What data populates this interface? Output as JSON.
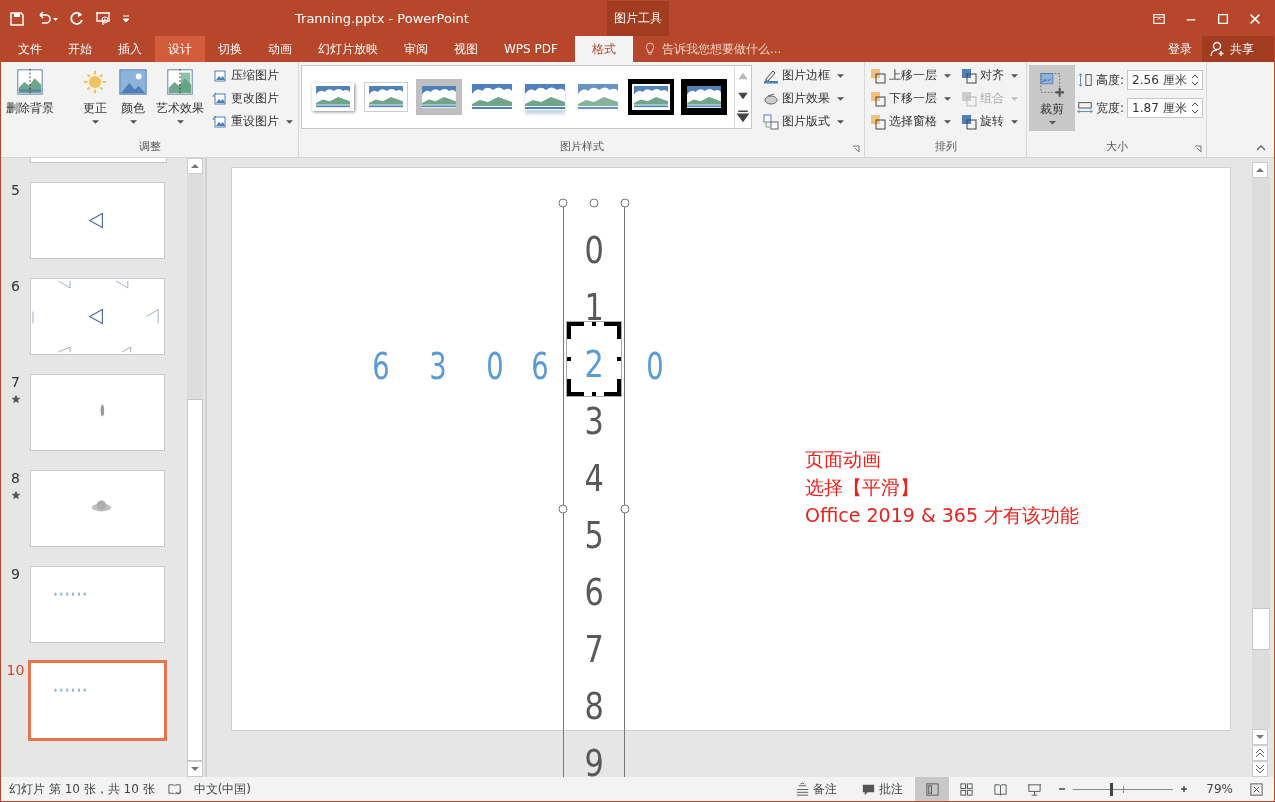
{
  "window": {
    "title": "Tranning.pptx - PowerPoint",
    "context_group": "图片工具"
  },
  "tabs": [
    {
      "label": "文件",
      "selected": false,
      "highlighted": false
    },
    {
      "label": "开始",
      "selected": false,
      "highlighted": false
    },
    {
      "label": "插入",
      "selected": false,
      "highlighted": false
    },
    {
      "label": "设计",
      "selected": false,
      "highlighted": true
    },
    {
      "label": "切换",
      "selected": false,
      "highlighted": false
    },
    {
      "label": "动画",
      "selected": false,
      "highlighted": false
    },
    {
      "label": "幻灯片放映",
      "selected": false,
      "highlighted": false
    },
    {
      "label": "审阅",
      "selected": false,
      "highlighted": false
    },
    {
      "label": "视图",
      "selected": false,
      "highlighted": false
    },
    {
      "label": "WPS PDF",
      "selected": false,
      "highlighted": false
    },
    {
      "label": "格式",
      "selected": true,
      "highlighted": false
    }
  ],
  "tell_me": {
    "placeholder": "告诉我您想要做什么..."
  },
  "sign_in": "登录",
  "share": "共享",
  "ribbon": {
    "adjust": {
      "label": "调整",
      "remove_background": "删除背景",
      "large": [
        {
          "label": "更正"
        },
        {
          "label": "颜色"
        },
        {
          "label": "艺术效果"
        }
      ],
      "small": [
        {
          "label": "压缩图片",
          "dropdown": false
        },
        {
          "label": "更改图片",
          "dropdown": false
        },
        {
          "label": "重设图片",
          "dropdown": true
        }
      ]
    },
    "styles": {
      "label": "图片样式",
      "gallery": [
        {
          "kind": "shadow"
        },
        {
          "kind": "white"
        },
        {
          "kind": "gray"
        },
        {
          "kind": "soft"
        },
        {
          "kind": "reflect"
        },
        {
          "kind": "fade"
        },
        {
          "kind": "double"
        },
        {
          "kind": "black"
        }
      ],
      "commands": [
        {
          "label": "图片边框"
        },
        {
          "label": "图片效果"
        },
        {
          "label": "图片版式"
        }
      ]
    },
    "arrange": {
      "label": "排列",
      "commands": [
        {
          "label": "上移一层",
          "disabled": false
        },
        {
          "label": "对齐",
          "disabled": false
        },
        {
          "label": "下移一层",
          "disabled": false
        },
        {
          "label": "组合",
          "disabled": true
        },
        {
          "label": "选择窗格",
          "disabled": false
        },
        {
          "label": "旋转",
          "disabled": false
        }
      ]
    },
    "size": {
      "label": "大小",
      "crop": {
        "label": "裁剪",
        "selected": true
      },
      "height": {
        "label": "高度:",
        "value": "2.56 厘米"
      },
      "width": {
        "label": "宽度:",
        "value": "1.87 厘米"
      }
    }
  },
  "slides": [
    {
      "number": "5",
      "kind": "triangle",
      "animated": false,
      "selected": false
    },
    {
      "number": "6",
      "kind": "triangles",
      "animated": false,
      "selected": false
    },
    {
      "number": "7",
      "kind": "feather",
      "animated": true,
      "selected": false
    },
    {
      "number": "8",
      "kind": "blur",
      "animated": true,
      "selected": false
    },
    {
      "number": "9",
      "kind": "dots",
      "animated": false,
      "selected": false
    },
    {
      "number": "10",
      "kind": "dots",
      "animated": false,
      "selected": true
    }
  ],
  "slide": {
    "digit_column": [
      {
        "text": "0",
        "highlighted": false
      },
      {
        "text": "1",
        "highlighted": false
      },
      {
        "text": "2",
        "highlighted": true
      },
      {
        "text": "3",
        "highlighted": false
      },
      {
        "text": "4",
        "highlighted": false
      },
      {
        "text": "5",
        "highlighted": false
      },
      {
        "text": "6",
        "highlighted": false
      },
      {
        "text": "7",
        "highlighted": false
      },
      {
        "text": "8",
        "highlighted": false
      },
      {
        "text": "9",
        "highlighted": false
      }
    ],
    "blue_digits": [
      {
        "text": "6"
      },
      {
        "text": "3"
      },
      {
        "text": "0"
      },
      {
        "text": "6"
      },
      {
        "text": "0"
      }
    ],
    "notes": [
      "页面动画",
      "选择【平滑】",
      "Office 2019 & 365 才有该功能"
    ]
  },
  "status_bar": {
    "slide_info": "幻灯片 第 10 张，共 10 张",
    "language": "中文(中国)",
    "notes": "备注",
    "comments": "批注",
    "views": [
      {
        "selected": true
      },
      {
        "selected": false
      },
      {
        "selected": false
      },
      {
        "selected": false
      }
    ],
    "zoom": {
      "level": 0.38,
      "reading": "79%"
    }
  }
}
